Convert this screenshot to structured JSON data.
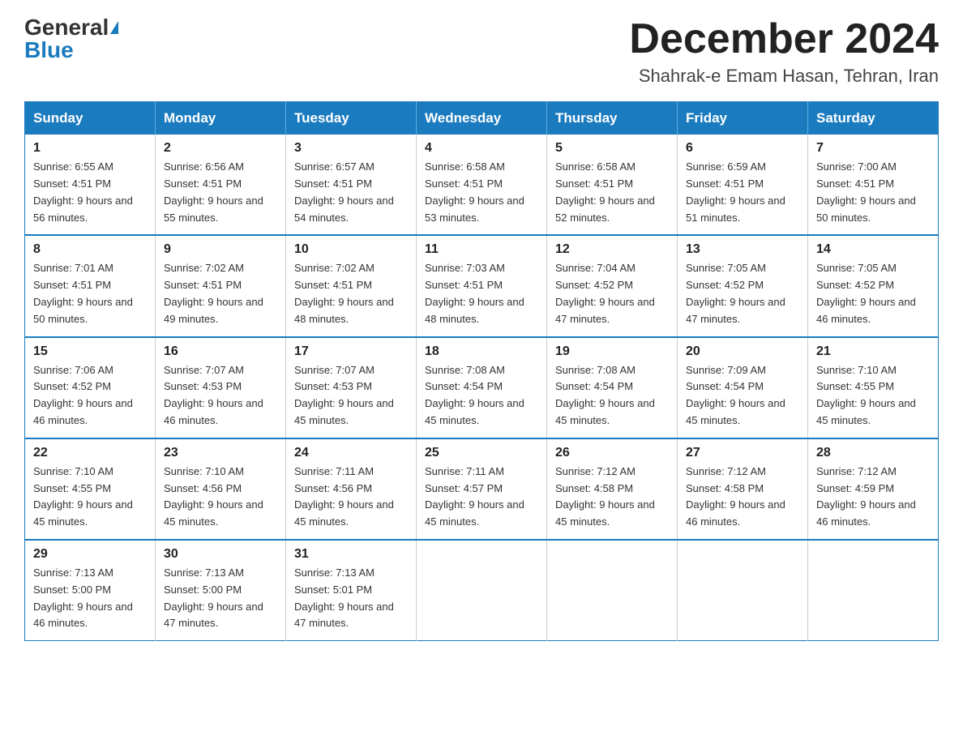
{
  "header": {
    "logo_general": "General",
    "logo_blue": "Blue",
    "month_title": "December 2024",
    "location": "Shahrak-e Emam Hasan, Tehran, Iran"
  },
  "days_of_week": [
    "Sunday",
    "Monday",
    "Tuesday",
    "Wednesday",
    "Thursday",
    "Friday",
    "Saturday"
  ],
  "weeks": [
    [
      {
        "day": "1",
        "sunrise": "6:55 AM",
        "sunset": "4:51 PM",
        "daylight": "9 hours and 56 minutes."
      },
      {
        "day": "2",
        "sunrise": "6:56 AM",
        "sunset": "4:51 PM",
        "daylight": "9 hours and 55 minutes."
      },
      {
        "day": "3",
        "sunrise": "6:57 AM",
        "sunset": "4:51 PM",
        "daylight": "9 hours and 54 minutes."
      },
      {
        "day": "4",
        "sunrise": "6:58 AM",
        "sunset": "4:51 PM",
        "daylight": "9 hours and 53 minutes."
      },
      {
        "day": "5",
        "sunrise": "6:58 AM",
        "sunset": "4:51 PM",
        "daylight": "9 hours and 52 minutes."
      },
      {
        "day": "6",
        "sunrise": "6:59 AM",
        "sunset": "4:51 PM",
        "daylight": "9 hours and 51 minutes."
      },
      {
        "day": "7",
        "sunrise": "7:00 AM",
        "sunset": "4:51 PM",
        "daylight": "9 hours and 50 minutes."
      }
    ],
    [
      {
        "day": "8",
        "sunrise": "7:01 AM",
        "sunset": "4:51 PM",
        "daylight": "9 hours and 50 minutes."
      },
      {
        "day": "9",
        "sunrise": "7:02 AM",
        "sunset": "4:51 PM",
        "daylight": "9 hours and 49 minutes."
      },
      {
        "day": "10",
        "sunrise": "7:02 AM",
        "sunset": "4:51 PM",
        "daylight": "9 hours and 48 minutes."
      },
      {
        "day": "11",
        "sunrise": "7:03 AM",
        "sunset": "4:51 PM",
        "daylight": "9 hours and 48 minutes."
      },
      {
        "day": "12",
        "sunrise": "7:04 AM",
        "sunset": "4:52 PM",
        "daylight": "9 hours and 47 minutes."
      },
      {
        "day": "13",
        "sunrise": "7:05 AM",
        "sunset": "4:52 PM",
        "daylight": "9 hours and 47 minutes."
      },
      {
        "day": "14",
        "sunrise": "7:05 AM",
        "sunset": "4:52 PM",
        "daylight": "9 hours and 46 minutes."
      }
    ],
    [
      {
        "day": "15",
        "sunrise": "7:06 AM",
        "sunset": "4:52 PM",
        "daylight": "9 hours and 46 minutes."
      },
      {
        "day": "16",
        "sunrise": "7:07 AM",
        "sunset": "4:53 PM",
        "daylight": "9 hours and 46 minutes."
      },
      {
        "day": "17",
        "sunrise": "7:07 AM",
        "sunset": "4:53 PM",
        "daylight": "9 hours and 45 minutes."
      },
      {
        "day": "18",
        "sunrise": "7:08 AM",
        "sunset": "4:54 PM",
        "daylight": "9 hours and 45 minutes."
      },
      {
        "day": "19",
        "sunrise": "7:08 AM",
        "sunset": "4:54 PM",
        "daylight": "9 hours and 45 minutes."
      },
      {
        "day": "20",
        "sunrise": "7:09 AM",
        "sunset": "4:54 PM",
        "daylight": "9 hours and 45 minutes."
      },
      {
        "day": "21",
        "sunrise": "7:10 AM",
        "sunset": "4:55 PM",
        "daylight": "9 hours and 45 minutes."
      }
    ],
    [
      {
        "day": "22",
        "sunrise": "7:10 AM",
        "sunset": "4:55 PM",
        "daylight": "9 hours and 45 minutes."
      },
      {
        "day": "23",
        "sunrise": "7:10 AM",
        "sunset": "4:56 PM",
        "daylight": "9 hours and 45 minutes."
      },
      {
        "day": "24",
        "sunrise": "7:11 AM",
        "sunset": "4:56 PM",
        "daylight": "9 hours and 45 minutes."
      },
      {
        "day": "25",
        "sunrise": "7:11 AM",
        "sunset": "4:57 PM",
        "daylight": "9 hours and 45 minutes."
      },
      {
        "day": "26",
        "sunrise": "7:12 AM",
        "sunset": "4:58 PM",
        "daylight": "9 hours and 45 minutes."
      },
      {
        "day": "27",
        "sunrise": "7:12 AM",
        "sunset": "4:58 PM",
        "daylight": "9 hours and 46 minutes."
      },
      {
        "day": "28",
        "sunrise": "7:12 AM",
        "sunset": "4:59 PM",
        "daylight": "9 hours and 46 minutes."
      }
    ],
    [
      {
        "day": "29",
        "sunrise": "7:13 AM",
        "sunset": "5:00 PM",
        "daylight": "9 hours and 46 minutes."
      },
      {
        "day": "30",
        "sunrise": "7:13 AM",
        "sunset": "5:00 PM",
        "daylight": "9 hours and 47 minutes."
      },
      {
        "day": "31",
        "sunrise": "7:13 AM",
        "sunset": "5:01 PM",
        "daylight": "9 hours and 47 minutes."
      },
      null,
      null,
      null,
      null
    ]
  ]
}
